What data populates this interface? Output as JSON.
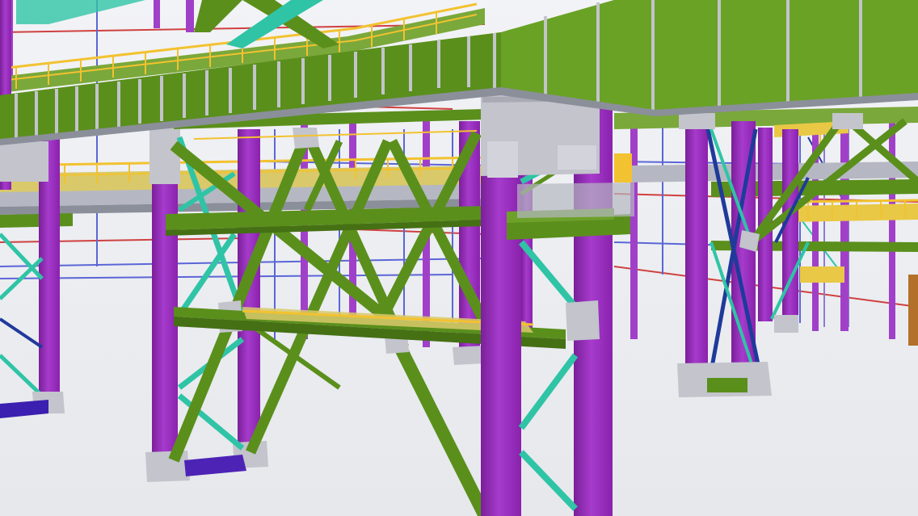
{
  "viewport": {
    "view_mode": "3D",
    "colors": {
      "background_top": "#f2f3f6",
      "background_bottom": "#e6e8ec",
      "column": "#9b2bbf",
      "column_dark": "#7a1f99",
      "beam": "#5a8f1c",
      "beam_dark": "#457014",
      "brace_cyan": "#2fc4a6",
      "brace_blue": "#1f3a9a",
      "handrail": "#f2c230",
      "grating": "#d9c96a",
      "connection_plate": "#c3c4cc",
      "red_line": "#d04040",
      "orange_object": "#b3702a"
    }
  }
}
